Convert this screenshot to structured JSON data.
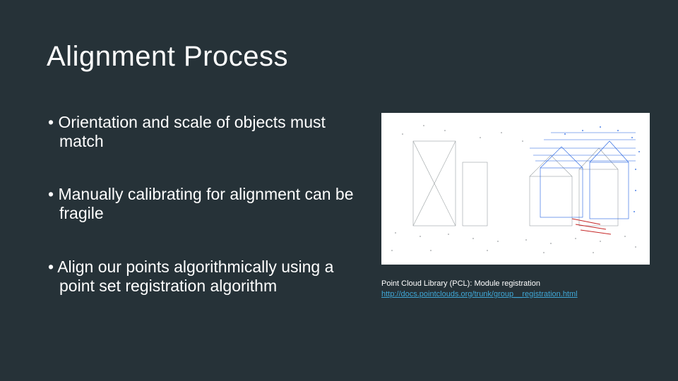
{
  "title": "Alignment Process",
  "bullets": [
    "Orientation and scale of objects must match",
    "Manually calibrating for alignment can be fragile",
    "Align our points algorithmically using a point set registration algorithm"
  ],
  "caption": {
    "text": "Point Cloud Library (PCL): Module registration",
    "link": "http://docs.pointclouds.org/trunk/group__registration.html"
  }
}
